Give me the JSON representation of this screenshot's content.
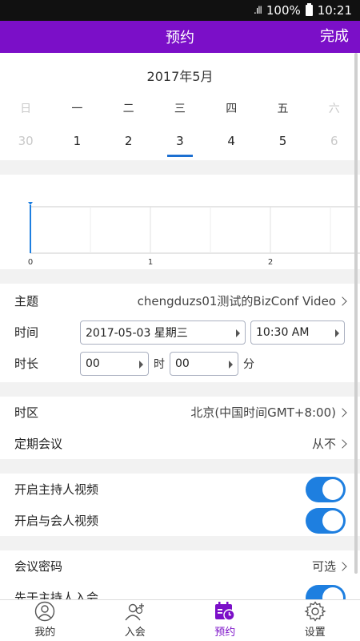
{
  "status": {
    "signal": ".ıll",
    "battery_pct": "100%",
    "time": "10:21"
  },
  "appbar": {
    "title": "预约",
    "done_label": "完成"
  },
  "calendar": {
    "month_title": "2017年5月",
    "weekdays": [
      "日",
      "一",
      "二",
      "三",
      "四",
      "五",
      "六"
    ],
    "days": [
      "30",
      "1",
      "2",
      "3",
      "4",
      "5",
      "6"
    ],
    "selected_index": 3
  },
  "timeline": {
    "ticks": [
      "0",
      "1",
      "2"
    ]
  },
  "topic": {
    "label": "主题",
    "value": "chengduzs01测试的BizConf Video"
  },
  "time": {
    "label": "时间",
    "date": "2017-05-03 星期三",
    "clock": "10:30 AM"
  },
  "duration": {
    "label": "时长",
    "hours": "00",
    "hour_unit": "时",
    "minutes": "00",
    "minute_unit": "分"
  },
  "timezone": {
    "label": "时区",
    "value": "北京(中国时间GMT+8:00)"
  },
  "recurring": {
    "label": "定期会议",
    "value": "从不"
  },
  "host_video": {
    "label": "开启主持人视频",
    "on": true
  },
  "participant_video": {
    "label": "开启与会人视频",
    "on": true
  },
  "password": {
    "label": "会议密码",
    "value": "可选"
  },
  "join_before_host": {
    "label": "先于主持人入会",
    "on": true
  },
  "tabs": [
    {
      "label": "我的",
      "icon": "user-icon"
    },
    {
      "label": "入会",
      "icon": "join-icon"
    },
    {
      "label": "预约",
      "icon": "schedule-icon",
      "active": true
    },
    {
      "label": "设置",
      "icon": "gear-icon"
    }
  ],
  "colors": {
    "accent": "#7b0fc8",
    "toggle": "#1e7fe0",
    "selected": "#1c6fd1"
  }
}
